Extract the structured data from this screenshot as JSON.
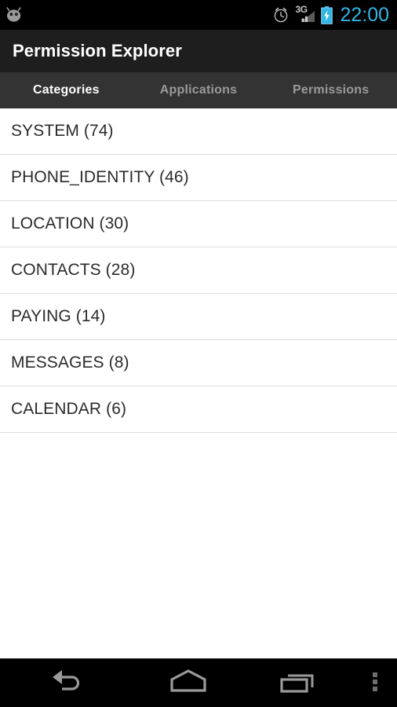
{
  "status_bar": {
    "left_icon": "android-droid-icon",
    "icons": [
      "alarm-icon",
      "signal-3g-icon",
      "battery-charging-icon"
    ],
    "network_label": "3G",
    "clock": "22:00",
    "clock_color": "#33b5e5",
    "background_color": "#000000"
  },
  "action_bar": {
    "title": "Permission Explorer",
    "background_color": "#1e1e1e",
    "title_color": "#ffffff"
  },
  "tabs": {
    "background_color": "#333333",
    "active_color": "#ffffff",
    "inactive_color": "#9a9a9a",
    "items": [
      {
        "label": "Categories",
        "active": true
      },
      {
        "label": "Applications",
        "active": false
      },
      {
        "label": "Permissions",
        "active": false
      }
    ]
  },
  "list": {
    "background_color": "#ffffff",
    "divider_color": "#dedede",
    "text_color": "#2b2b2b",
    "items": [
      {
        "name": "SYSTEM",
        "count": 74,
        "label": "SYSTEM (74)"
      },
      {
        "name": "PHONE_IDENTITY",
        "count": 46,
        "label": "PHONE_IDENTITY (46)"
      },
      {
        "name": "LOCATION",
        "count": 30,
        "label": "LOCATION (30)"
      },
      {
        "name": "CONTACTS",
        "count": 28,
        "label": "CONTACTS (28)"
      },
      {
        "name": "PAYING",
        "count": 14,
        "label": "PAYING (14)"
      },
      {
        "name": "MESSAGES",
        "count": 8,
        "label": "MESSAGES (8)"
      },
      {
        "name": "CALENDAR",
        "count": 6,
        "label": "CALENDAR (6)"
      }
    ]
  },
  "nav_bar": {
    "background_color": "#000000",
    "icon_color": "#9a9a9a",
    "buttons": [
      {
        "icon": "back-icon",
        "label": "Back"
      },
      {
        "icon": "home-icon",
        "label": "Home"
      },
      {
        "icon": "recents-icon",
        "label": "Recent apps"
      },
      {
        "icon": "overflow-menu-icon",
        "label": "Menu"
      }
    ]
  }
}
